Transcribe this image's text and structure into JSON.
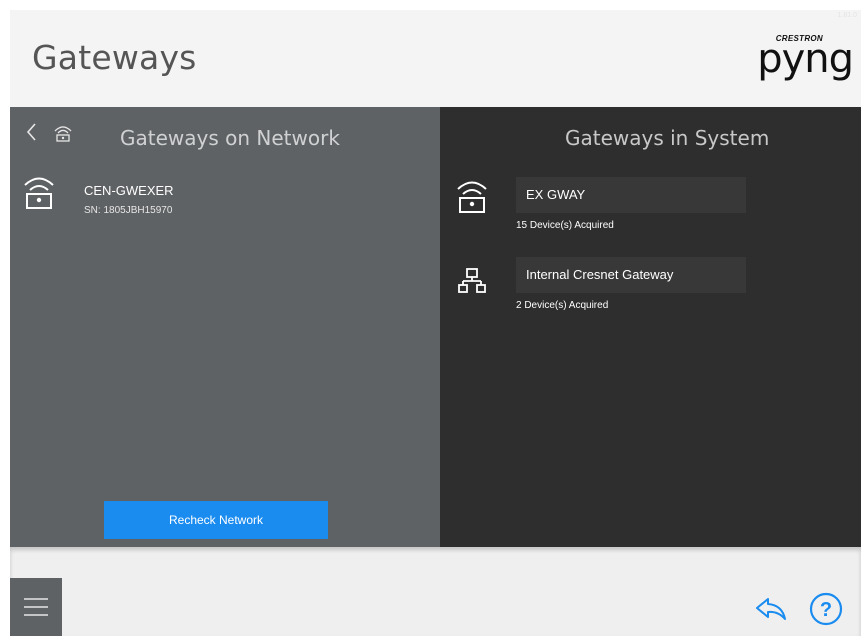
{
  "header": {
    "title": "Gateways",
    "logo_brand": "CRESTRON",
    "logo_word": "pyng",
    "version": "1.81.0"
  },
  "left_panel": {
    "title": "Gateways on Network",
    "items": [
      {
        "name": "CEN-GWEXER",
        "serial": "SN: 1805JBH15970",
        "icon": "wireless-gateway-icon"
      }
    ],
    "recheck_label": "Recheck Network"
  },
  "right_panel": {
    "title": "Gateways in System",
    "items": [
      {
        "name": "EX GWAY",
        "count": "15 Device(s) Acquired",
        "icon": "wireless-gateway-icon"
      },
      {
        "name": "Internal Cresnet Gateway",
        "count": "2 Device(s) Acquired",
        "icon": "network-tree-icon"
      }
    ]
  },
  "footer": {
    "menu_icon": "hamburger-menu-icon",
    "share_icon": "share-back-icon",
    "help_icon": "help-icon"
  },
  "colors": {
    "accent": "#1a8cf0",
    "left_panel_bg": "#5f6264",
    "right_panel_bg": "#2e2e2e",
    "item_box_bg": "#383838",
    "icon_blue": "#1a8cf0"
  }
}
